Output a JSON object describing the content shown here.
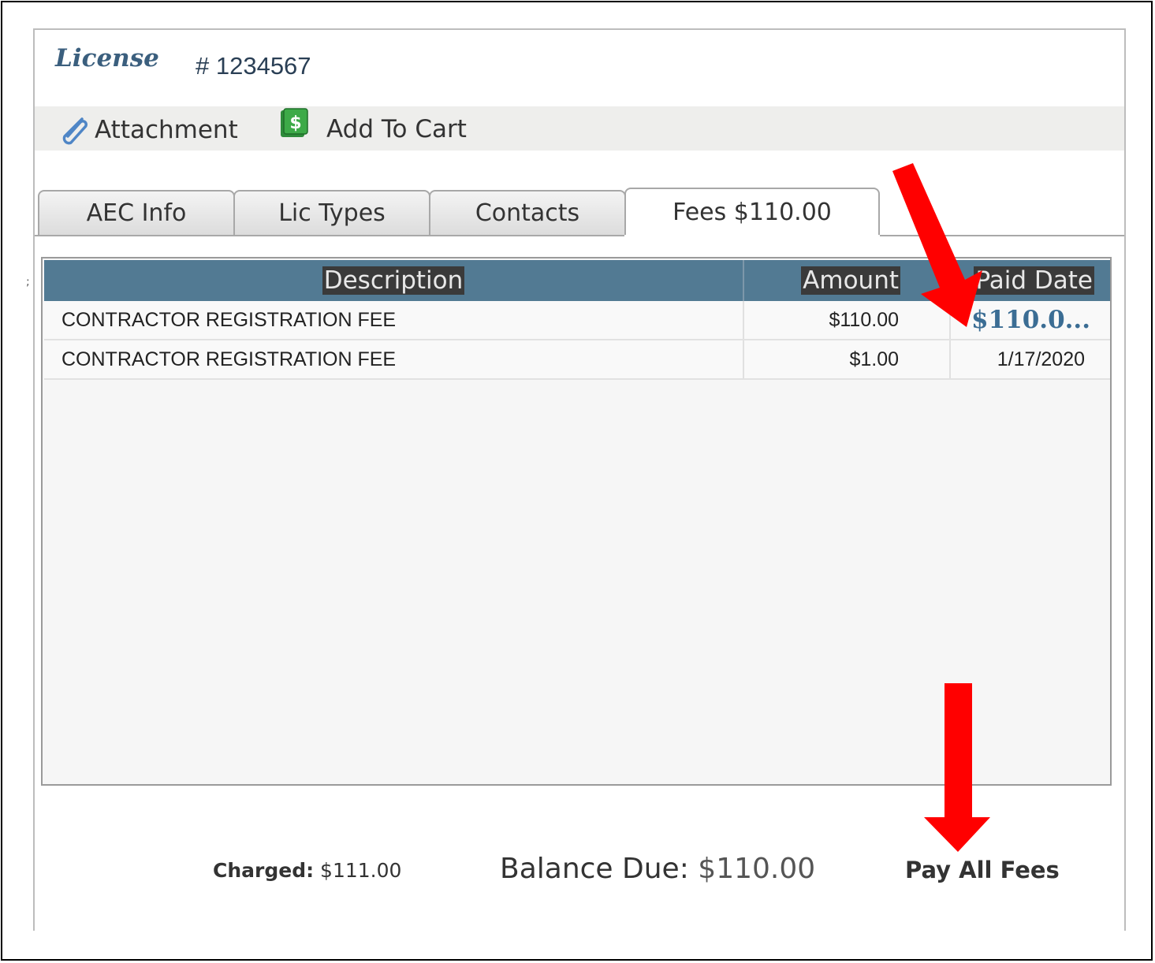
{
  "header": {
    "title_italic": "License",
    "license_number": "# 1234567"
  },
  "toolbar": {
    "attachment_label": "Attachment",
    "add_to_cart_label": "Add To Cart"
  },
  "tabs": [
    {
      "label": "AEC Info",
      "active": false
    },
    {
      "label": "Lic Types",
      "active": false
    },
    {
      "label": "Contacts",
      "active": false
    },
    {
      "label": "Fees $110.00",
      "active": true
    }
  ],
  "fees_table": {
    "columns": [
      "Description",
      "Amount",
      "Paid Date"
    ],
    "rows": [
      {
        "description": "CONTRACTOR REGISTRATION FEE",
        "amount": "$110.00",
        "paid_date": "$110.0..."
      },
      {
        "description": "CONTRACTOR REGISTRATION FEE",
        "amount": "$1.00",
        "paid_date": "1/17/2020"
      }
    ]
  },
  "footer": {
    "charged_label": "Charged:",
    "charged_value": "$111.00",
    "balance_label": "Balance Due:",
    "balance_value": "$110.00",
    "pay_all_label": "Pay All Fees"
  },
  "colors": {
    "header_bg": "#527a93",
    "title_blue": "#3b5f7e",
    "arrow_red": "#ff0000",
    "link_blue": "#3b6d94"
  },
  "icons": [
    "paperclip-icon",
    "dollar-cart-icon",
    "red-arrow-diagonal",
    "red-arrow-down"
  ],
  "stray_glyph": ";"
}
